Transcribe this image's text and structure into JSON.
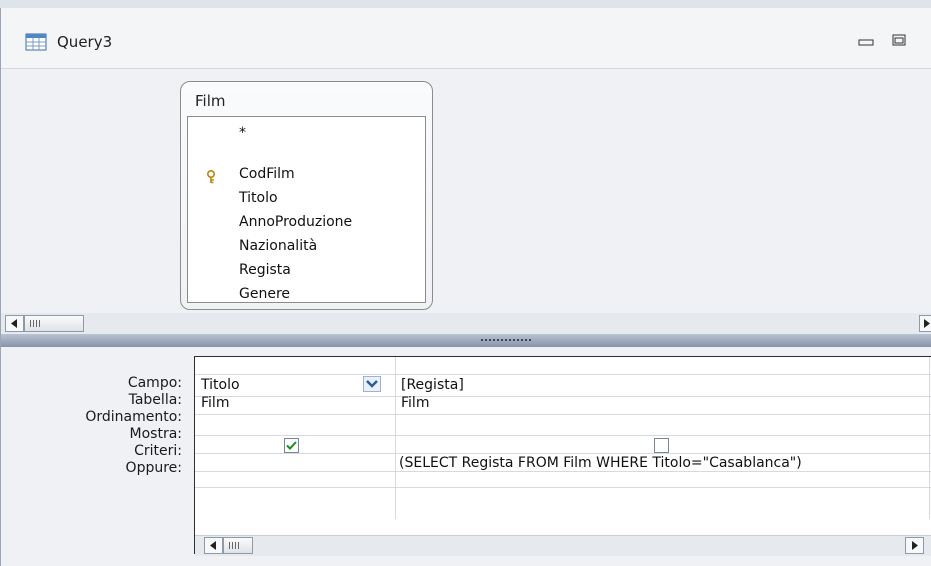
{
  "window": {
    "title": "Query3",
    "icon": "query-datasheet-icon",
    "buttons": [
      "minimize-icon",
      "maximize-icon"
    ]
  },
  "table": {
    "name": "Film",
    "fields": [
      {
        "name": "*",
        "primary_key": false
      },
      {
        "name": "CodFilm",
        "primary_key": true
      },
      {
        "name": "Titolo",
        "primary_key": false
      },
      {
        "name": "AnnoProduzione",
        "primary_key": false
      },
      {
        "name": "Nazionalità",
        "primary_key": false
      },
      {
        "name": "Regista",
        "primary_key": false
      },
      {
        "name": "Genere",
        "primary_key": false
      }
    ]
  },
  "grid": {
    "row_labels": [
      "Campo:",
      "Tabella:",
      "Ordinamento:",
      "Mostra:",
      "Criteri:",
      "Oppure:"
    ],
    "columns": [
      {
        "campo": "Titolo",
        "tabella": "Film",
        "ordinamento": "",
        "mostra": true,
        "criteri": "",
        "oppure": "",
        "has_dropdown": true
      },
      {
        "campo": "[Regista]",
        "tabella": "Film",
        "ordinamento": "",
        "mostra": false,
        "criteri": "(SELECT Regista FROM Film WHERE Titolo=\"Casablanca\")",
        "oppure": "",
        "has_dropdown": false
      }
    ]
  },
  "colors": {
    "check_mark": "#1f8a1f",
    "splitter": "#8693a8",
    "dropdown_arrow": "#2c5aa0"
  }
}
